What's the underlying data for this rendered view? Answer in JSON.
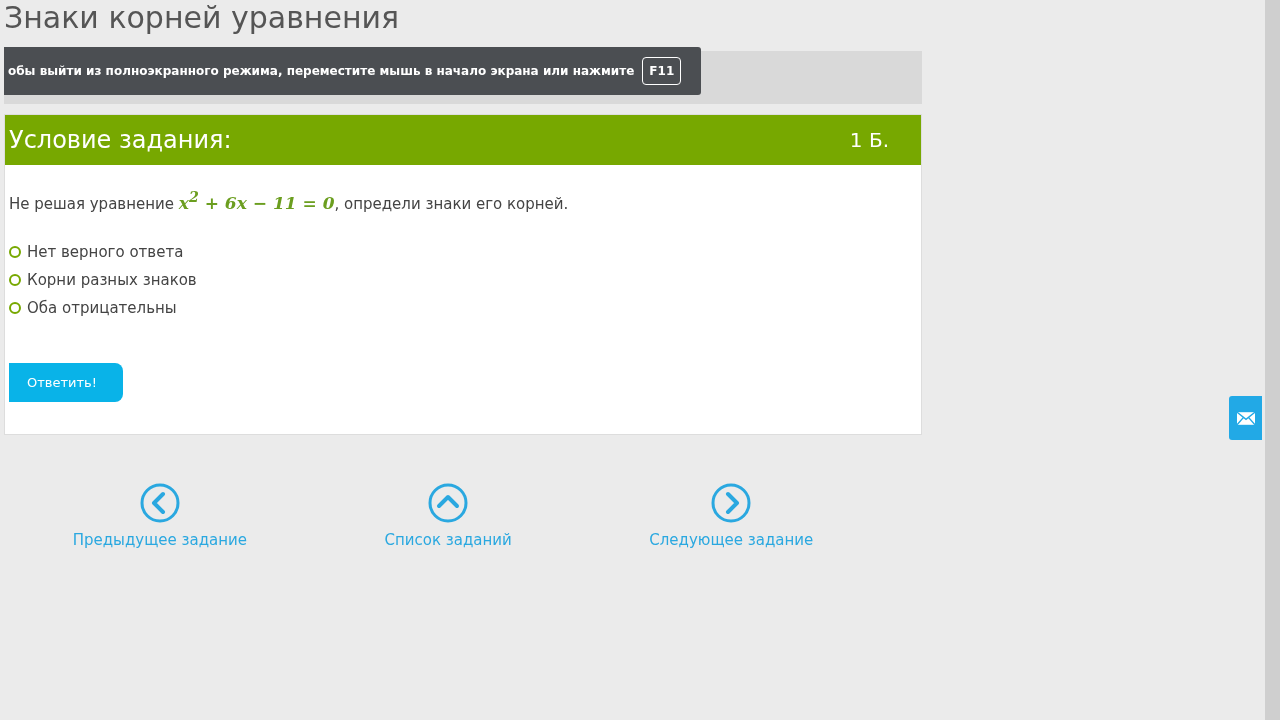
{
  "page_title": "Знаки корней уравнения",
  "fullscreen_tooltip": {
    "text": "обы выйти из полноэкранного режима, переместите мышь в начало экрана или нажмите",
    "key": "F11"
  },
  "task": {
    "heading": "Условие задания:",
    "points": "1 Б.",
    "question": {
      "before": "Не решая уравнение",
      "math": "x$^{2}$ + 6x − 11 = 0",
      "after": ", определи знаки его корней."
    },
    "options": [
      {
        "label": "Нет верного ответа",
        "selected": false
      },
      {
        "label": "Корни разных знаков",
        "selected": false
      },
      {
        "label": "Оба отрицательны",
        "selected": false
      }
    ],
    "submit": "Ответить!"
  },
  "nav": [
    {
      "kind": "prev",
      "label": "Предыдущее задание"
    },
    {
      "kind": "list",
      "label": "Список заданий"
    },
    {
      "kind": "next",
      "label": "Следующее задание"
    }
  ]
}
